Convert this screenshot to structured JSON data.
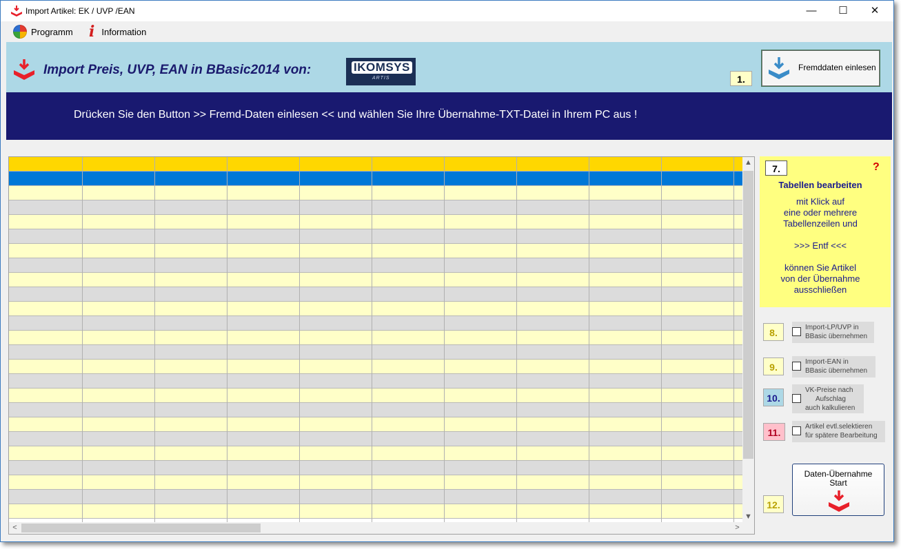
{
  "window": {
    "title": "Import Artikel:  EK / UVP /EAN",
    "minimize": "—",
    "maximize": "☐",
    "close": "✕"
  },
  "menu": {
    "programm": "Programm",
    "information": "Information"
  },
  "header": {
    "title": "Import Preis, UVP, EAN in BBasic2014  von:",
    "logo_main": "IKOMSYS",
    "logo_sub": "ARTIS",
    "step1": "1.",
    "fremd_button": "Fremddaten einlesen"
  },
  "instruction": "Drücken Sie den Button >> Fremd-Daten einlesen << und wählen Sie Ihre Übernahme-TXT-Datei in Ihrem PC aus !",
  "grid": {
    "columns": 11,
    "rows": 25,
    "colors": {
      "header": "#ffd700",
      "selected": "#0078d7",
      "odd": "#ffffc8",
      "even": "#dcdcdc"
    },
    "scroll_up": "▲",
    "scroll_down": "▼",
    "scroll_left": "<",
    "scroll_right": ">"
  },
  "info": {
    "step7": "7.",
    "help": "?",
    "title": "Tabellen bearbeiten",
    "line1": "mit  Klick auf",
    "line2": "eine oder mehrere",
    "line3": "Tabellenzeilen und",
    "line4": ">>> Entf <<<",
    "line5": "können Sie Artikel",
    "line6": "von der Übernahme",
    "line7": "ausschließen"
  },
  "options": {
    "step8": "8.",
    "opt8_l1": "Import-LP/UVP in",
    "opt8_l2": "BBasic übernehmen",
    "step9": "9.",
    "opt9_l1": "Import-EAN in",
    "opt9_l2": "BBasic übernehmen",
    "step10": "10.",
    "opt10_l1": "VK-Preise nach",
    "opt10_l2": "Aufschlag",
    "opt10_l3": "auch kalkulieren",
    "step11": "11.",
    "opt11_l1": "Artikel evtl.selektieren",
    "opt11_l2": "für spätere Bearbeitung"
  },
  "start": {
    "step12": "12.",
    "line1": "Daten-Übernahme",
    "line2": "Start"
  },
  "colors": {
    "header_band": "#add8e6",
    "dark_band": "#191970",
    "info_panel": "#ffff80",
    "accent_red": "#e8202a"
  }
}
